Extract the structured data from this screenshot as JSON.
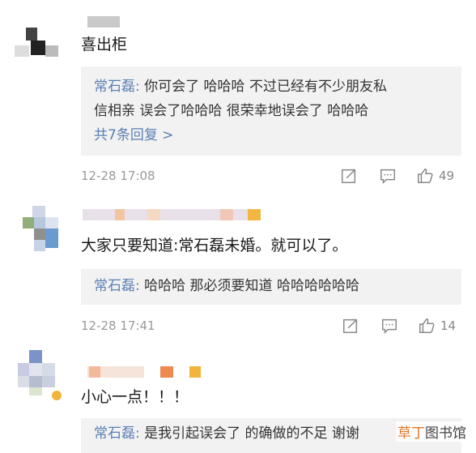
{
  "comments": [
    {
      "body": "喜出柜",
      "reply": {
        "author": "常石磊:",
        "text": " 你可会了 哈哈哈 不过已经有不少朋友私信相亲 误会了哈哈哈 很荣幸地误会了 哈哈哈",
        "line1": " 你可会了 哈哈哈 不过已经有不少朋友私",
        "line2": "信相亲 误会了哈哈哈 很荣幸地误会了 哈哈哈",
        "more": "共7条回复 >"
      },
      "time": "12-28 17:08",
      "likes": "49"
    },
    {
      "body": "大家只要知道:常石磊未婚。就可以了。",
      "reply": {
        "author": "常石磊:",
        "text": " 哈哈哈 那必须要知道 哈哈哈哈哈哈"
      },
      "time": "12-28 17:41",
      "likes": "14"
    },
    {
      "body": "小心一点！！！",
      "reply": {
        "author": "常石磊:",
        "text": " 是我引起误会了 的确做的不足 谢谢"
      }
    }
  ],
  "watermark": {
    "part1": "草丁",
    "part2": "图书馆"
  },
  "colors": {
    "link": "#5a7fb5",
    "muted": "#999999",
    "reply_bg": "#f2f2f2"
  }
}
